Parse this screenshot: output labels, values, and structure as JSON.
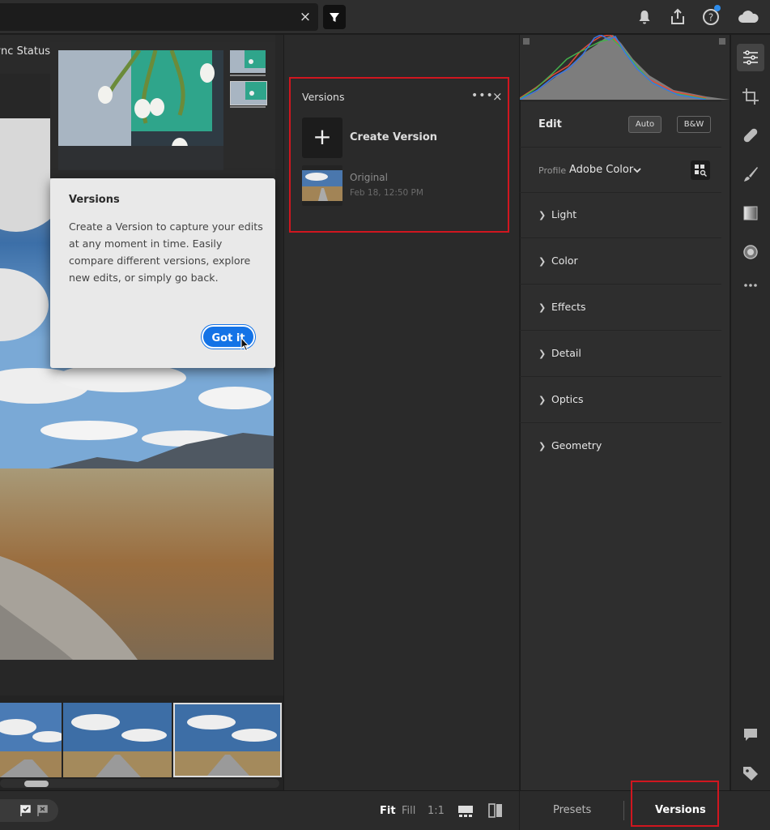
{
  "topbar": {
    "search_clear": "×",
    "icons": [
      "filter-icon",
      "bell-icon",
      "share-icon",
      "help-icon",
      "cloud-icon"
    ]
  },
  "grid": {
    "tab_label": "Sync Status"
  },
  "tooltip": {
    "title": "Versions",
    "body": "Create a Version to capture your edits at any moment in time. Easily compare different versions, explore new edits, or simply go back.",
    "button": "Got it"
  },
  "versions_panel": {
    "title": "Versions",
    "more": "•••",
    "close": "×",
    "create_plus": "+",
    "create_label": "Create Version",
    "original_label": "Original",
    "original_date": "Feb 18, 12:50 PM"
  },
  "edit_panel": {
    "title": "Edit",
    "auto_label": "Auto",
    "bw_label": "B&W",
    "profile_label": "Profile",
    "profile_value": "Adobe Color",
    "sections": [
      "Light",
      "Color",
      "Effects",
      "Detail",
      "Optics",
      "Geometry"
    ]
  },
  "bottom": {
    "zoom_fit": "Fit",
    "zoom_fill": "Fill",
    "zoom_1to1": "1:1",
    "presets": "Presets",
    "versions": "Versions"
  },
  "colors": {
    "accent": "#1473e6",
    "highlight_box": "#d0161f"
  }
}
